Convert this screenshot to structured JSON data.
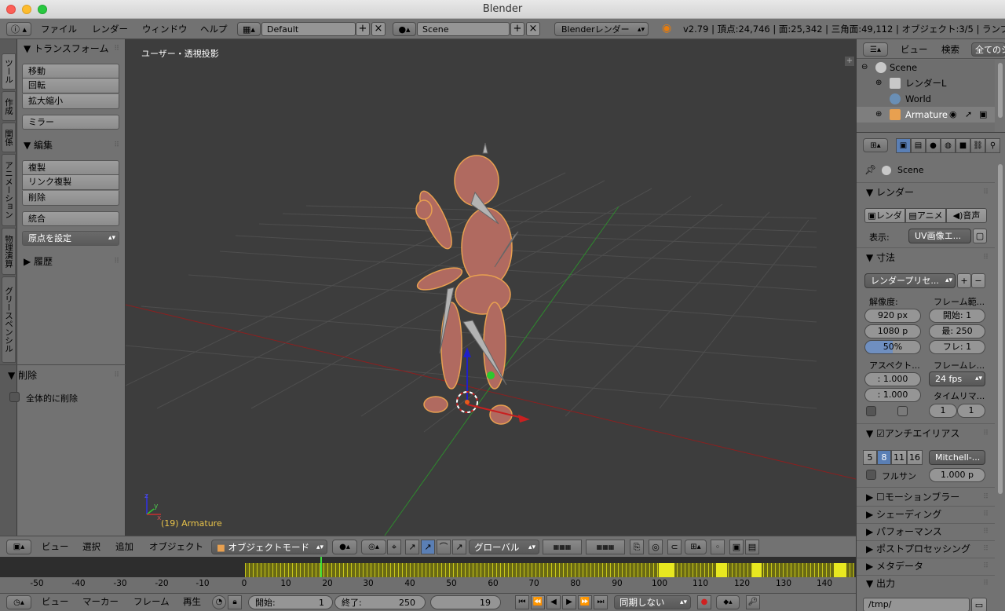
{
  "window": {
    "title": "Blender"
  },
  "infobar": {
    "menus": [
      "ファイル",
      "レンダー",
      "ウィンドウ",
      "ヘルプ"
    ],
    "layout": "Default",
    "scene": "Scene",
    "engine": "Blenderレンダー",
    "stats": "v2.79 | 頂点:24,746 | 面:25,342 | 三角面:49,112 | オブジェクト:3/5 | ランプ:0/"
  },
  "lefttabs": [
    "ツール",
    "作成",
    "関係",
    "アニメーション",
    "物理演算",
    "グリースペンシル"
  ],
  "toolshelf": {
    "transform_title": "トランスフォーム",
    "transform_buttons": [
      "移動",
      "回転",
      "拡大縮小"
    ],
    "mirror": "ミラー",
    "edit_title": "編集",
    "edit_buttons": [
      "複製",
      "リンク複製",
      "削除"
    ],
    "join": "統合",
    "origin": "原点を設定",
    "history_title": "履歴",
    "delete_title": "削除",
    "delete_global": "全体的に削除"
  },
  "viewport": {
    "label": "ユーザー・透視投影",
    "object_label": "(19) Armature"
  },
  "view_header": {
    "menus": [
      "ビュー",
      "選択",
      "追加",
      "オブジェクト"
    ],
    "mode": "オブジェクトモード",
    "orientation": "グローバル"
  },
  "timeline": {
    "ticks": [
      "-50",
      "-40",
      "-30",
      "-20",
      "-10",
      "0",
      "10",
      "20",
      "30",
      "40",
      "50",
      "60",
      "70",
      "80",
      "90",
      "100",
      "110",
      "120",
      "130",
      "140"
    ],
    "menus": [
      "ビュー",
      "マーカー",
      "フレーム",
      "再生"
    ],
    "start_label": "開始:",
    "start_value": "1",
    "end_label": "終了:",
    "end_value": "250",
    "current": "19",
    "sync": "同期しない"
  },
  "outliner": {
    "menus": [
      "ビュー",
      "検索"
    ],
    "filter": "全てのシ",
    "items": [
      "Scene",
      "レンダーL",
      "World",
      "Armature"
    ]
  },
  "properties": {
    "context": "Scene",
    "render_title": "レンダー",
    "render_buttons": [
      "レンダ",
      "アニメ",
      "音声"
    ],
    "display_label": "表示:",
    "display_value": "UV画像エ...",
    "dimensions_title": "寸法",
    "preset": "レンダープリセ...",
    "resolution_label": "解像度:",
    "res_x": "920 px",
    "res_y": "1080 p",
    "res_pct": "50%",
    "frame_range_label": "フレーム範...",
    "frame_start": "開始:",
    "frame_start_value": "1",
    "frame_end": "最:",
    "frame_end_value": "250",
    "frame_step": "フレ:",
    "frame_step_value": "1",
    "aspect_label": "アスペクト...",
    "aspect_x": "1.000",
    "aspect_y": "1.000",
    "framerate_label": "フレームレ...",
    "framerate": "24 fps",
    "timeremap_label": "タイムリマ...",
    "remap_old": "1",
    "remap_new": "1",
    "aa_title": "アンチエイリアス",
    "aa_samples": [
      "5",
      "8",
      "11",
      "16"
    ],
    "aa_filter": "Mitchell-...",
    "fullsample": "フルサン",
    "filter_size": "1.000 p",
    "sections": [
      "モーションブラー",
      "シェーディング",
      "パフォーマンス",
      "ポストプロセッシング",
      "メタデータ",
      "出力"
    ],
    "output_path": "/tmp/"
  }
}
